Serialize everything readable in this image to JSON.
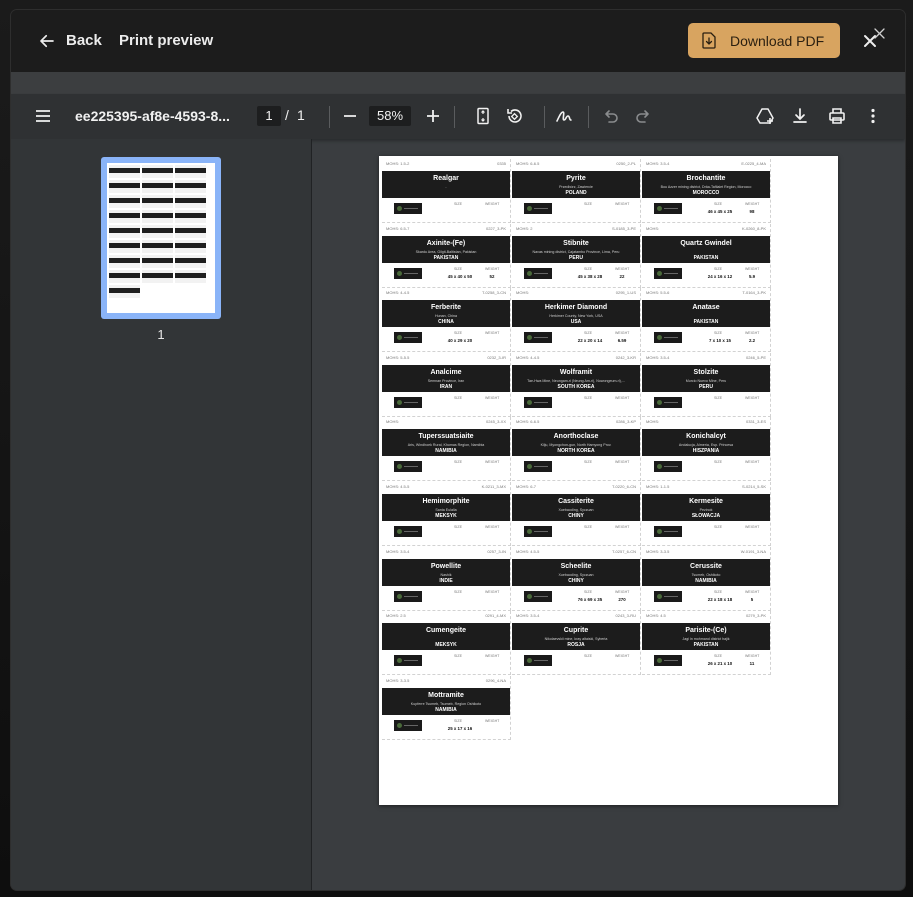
{
  "header": {
    "back_label": "Back",
    "title": "Print preview",
    "download_label": "Download PDF"
  },
  "toolbar": {
    "filename": "ee225395-af8e-4593-8...",
    "current_page": "1",
    "page_separator": "/",
    "page_count": "1",
    "zoom": "58%"
  },
  "sidebar": {
    "thumbnail_page_number": "1"
  },
  "labels": [
    {
      "mohs": "MOHS: 1.5-2",
      "code": "0335",
      "name": "Realgar",
      "location": "-",
      "country": ""
    },
    {
      "mohs": "MOHS: 6-6.5",
      "code": "0250_2-PL",
      "name": "Pyrite",
      "location": "Przedbórz, Zawiercie",
      "country": "POLAND"
    },
    {
      "mohs": "MOHS: 3.5-4",
      "code": "E-0225_4-MA",
      "name": "Brochantite",
      "location": "Bou Azzer mining district, Drâa-Tafilalet Region, Morocco",
      "country": "MOROCCO",
      "size": "46 x 45 x 25",
      "weight": "98"
    },
    {
      "mohs": "MOHS: 6.5-7",
      "code": "0227_3-PK",
      "name": "Axinite-(Fe)",
      "location": "Skardu Area, Gilgit-Baltistan, Pakistan",
      "country": "PAKISTAN",
      "size": "45 x 40 x 50",
      "weight": "52"
    },
    {
      "mohs": "MOHS: 2",
      "code": "S-0185_3-PE",
      "name": "Stibnite",
      "location": "Navas mining district, Cajatambo Province, Lima, Peru",
      "country": "PERU",
      "size": "45 x 38 x 28",
      "weight": "22"
    },
    {
      "mohs": "MOHS:",
      "code": "K-0260_8-PK",
      "name": "Quartz Gwindel",
      "location": "",
      "country": "PAKISTAN",
      "size": "24 x 16 x 12",
      "weight": "5.9"
    },
    {
      "mohs": "MOHS: 4-4.5",
      "code": "T-0258_3-CN",
      "name": "Ferberite",
      "location": "Hunan, China",
      "country": "CHINA",
      "size": "40 x 29 x 20",
      "weight": ""
    },
    {
      "mohs": "MOHS:",
      "code": "0295_1-US",
      "name": "Herkimer Diamond",
      "location": "Herkimer County, New York, USA",
      "country": "USA",
      "size": "22 x 20 x 14",
      "weight": "6.59"
    },
    {
      "mohs": "MOHS: 5.5-6",
      "code": "T-0164_3-PK",
      "name": "Anatase",
      "location": "",
      "country": "PAKISTAN",
      "size": "7 x 10 x 15",
      "weight": "2.2"
    },
    {
      "mohs": "MOHS: 5-5.5",
      "code": "0232_3-IR",
      "name": "Analcime",
      "location": "Semnan Province, Iran",
      "country": "IRAN",
      "size": "",
      "weight": ""
    },
    {
      "mohs": "MOHS: 4-4.5",
      "code": "0242_3-KR",
      "name": "Wolframit",
      "location": "Tae-Hwa Mine, Neungam-ri (Neung Am-ri), Nowongeum-ri),...",
      "country": "SOUTH KOREA",
      "size": "",
      "weight": ""
    },
    {
      "mohs": "MOHS: 3.5-4",
      "code": "0246_5-PE",
      "name": "Stolzite",
      "location": "Murcio Nuevo Mine, Peru",
      "country": "PERU",
      "size": "",
      "weight": ""
    },
    {
      "mohs": "MOHS:",
      "code": "0245_3-XX",
      "name": "Tuperssuatsiaite",
      "location": "Aris, Windhoek Rural, Khomas Region, Namibia",
      "country": "NAMIBIA",
      "size": "",
      "weight": ""
    },
    {
      "mohs": "MOHS: 6-6.5",
      "code": "0286_3-KP",
      "name": "Anorthoclase",
      "location": "Kilju, Myongchon-gun, North Hamyong Prov.",
      "country": "NORTH KOREA",
      "size": "",
      "weight": ""
    },
    {
      "mohs": "MOHS:",
      "code": "0331_3-ES",
      "name": "Konichalcyt",
      "location": "Andalucja, Almería, Esp. Princesa",
      "country": "HISZPANIA",
      "size": "",
      "weight": ""
    },
    {
      "mohs": "MOHS: 4.5-5",
      "code": "K-0211_3-MX",
      "name": "Hemimorphite",
      "location": "Santa Eulalia",
      "country": "MEKSYK",
      "size": "",
      "weight": ""
    },
    {
      "mohs": "MOHS: 6-7",
      "code": "T-0220_6-CN",
      "name": "Cassiterite",
      "location": "Xuebaoding, Syczuan",
      "country": "CHINY",
      "size": "",
      "weight": ""
    },
    {
      "mohs": "MOHS: 1-1.5",
      "code": "S-0214_5-SK",
      "name": "Kermesite",
      "location": "Pezinok",
      "country": "SŁOWACJA",
      "size": "",
      "weight": ""
    },
    {
      "mohs": "MOHS: 3.5-4",
      "code": "0257_3-IN",
      "name": "Powellite",
      "location": "Nashik",
      "country": "INDIE",
      "size": "",
      "weight": ""
    },
    {
      "mohs": "MOHS: 4.5-5",
      "code": "T-0257_6-CN",
      "name": "Scheelite",
      "location": "Xuebaoding, Syczuan",
      "country": "CHINY",
      "size": "76 x 69 x 35",
      "weight": "270"
    },
    {
      "mohs": "MOHS: 3-3.5",
      "code": "W-0191_3-NA",
      "name": "Cerussite",
      "location": "Tsumeb, Oshikoto",
      "country": "NAMIBIA",
      "size": "22 x 18 x 18",
      "weight": "5"
    },
    {
      "mohs": "MOHS: 2.5",
      "code": "0291_4-MX",
      "name": "Cumengeite",
      "location": "",
      "country": "MEKSYK",
      "size": "",
      "weight": ""
    },
    {
      "mohs": "MOHS: 3.5-4",
      "code": "0243_3-RU",
      "name": "Cuprite",
      "location": "Nikolaevskii mine, kray altaiski, Syberia",
      "country": "ROSJA",
      "size": "",
      "weight": ""
    },
    {
      "mohs": "MOHS: 4.5",
      "code": "0279_3-PK",
      "name": "Parisite-(Ce)",
      "location": "Jagi in mohmand district hajik",
      "country": "PAKISTAN",
      "size": "26 x 21 x 10",
      "weight": "11"
    },
    {
      "mohs": "MOHS: 3-3.5",
      "code": "0296_4-NA",
      "name": "Mottramite",
      "location": "Kupferre Tsumeb, Tsumeb, Region Oshikoto",
      "country": "NAMIBIA",
      "size": "25 x 17 x 16",
      "weight": ""
    }
  ],
  "label_headers": {
    "size": "SIZE",
    "weight": "WEIGHT"
  },
  "colors": {
    "accent": "#d8a460",
    "thumb_border": "#8ab4f8",
    "toolbar": "#2f3133",
    "label_band": "#1c1c1c"
  }
}
